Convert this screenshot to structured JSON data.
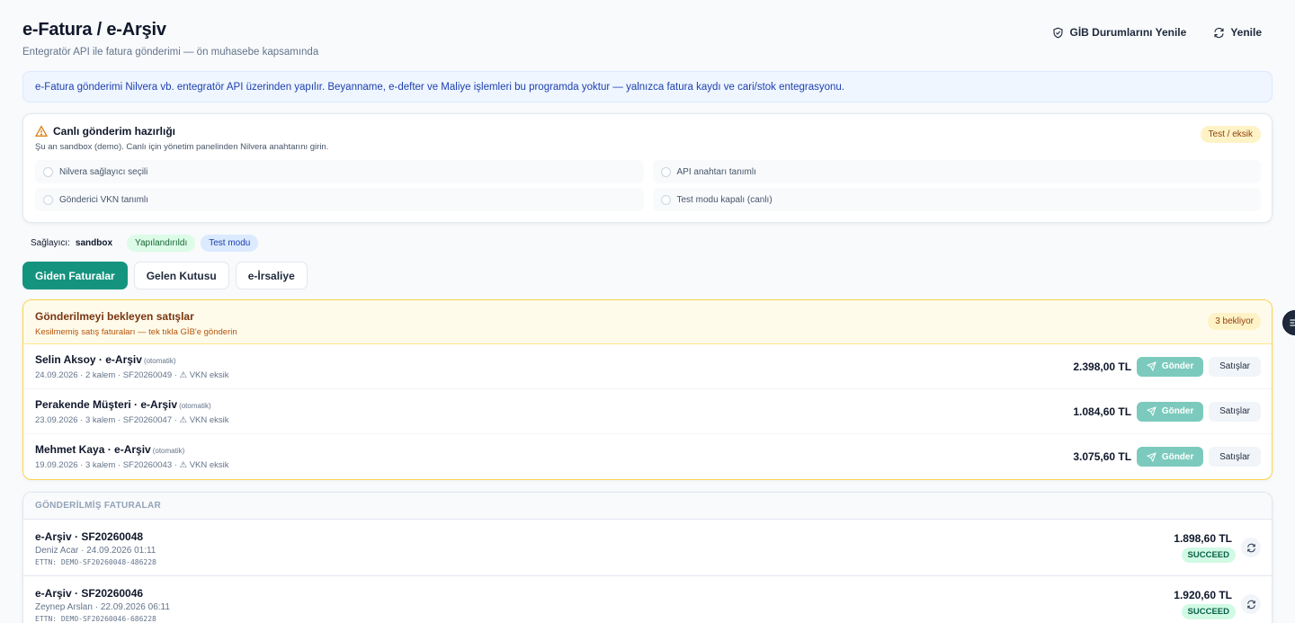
{
  "header": {
    "title": "e-Fatura / e-Arşiv",
    "subtitle": "Entegratör API ile fatura gönderimi — ön muhasebe kapsamında",
    "gib_refresh_label": "GİB Durumlarını Yenile",
    "refresh_label": "Yenile"
  },
  "info_banner": "e-Fatura gönderimi Nilvera vb. entegratör API üzerinden yapılır. Beyanname, e-defter ve Maliye işlemleri bu programda yoktur — yalnızca fatura kaydı ve cari/stok entegrasyonu.",
  "readiness": {
    "title": "Canlı gönderim hazırlığı",
    "subtitle": "Şu an sandbox (demo). Canlı için yönetim panelinden Nilvera anahtarını girin.",
    "badge": "Test / eksik",
    "checks": [
      "Nilvera sağlayıcı seçili",
      "API anahtarı tanımlı",
      "Gönderici VKN tanımlı",
      "Test modu kapalı (canlı)"
    ]
  },
  "provider": {
    "label": "Sağlayıcı:",
    "name": "sandbox",
    "status": "Yapılandırıldı",
    "mode": "Test modu"
  },
  "tabs": [
    "Giden Faturalar",
    "Gelen Kutusu",
    "e-İrsaliye"
  ],
  "pending": {
    "title": "Gönderilmeyi bekleyen satışlar",
    "subtitle": "Kesilmemiş satış faturaları — tek tıkla GİB'e gönderin",
    "badge": "3 bekliyor",
    "send_label": "Gönder",
    "sales_label": "Satışlar",
    "rows": [
      {
        "name": "Selin Aksoy · e-Arşiv",
        "tag": "(otomatik)",
        "meta": "24.09.2026 · 2 kalem · SF20260049 · ⚠ VKN eksik",
        "amount": "2.398,00 TL"
      },
      {
        "name": "Perakende Müşteri · e-Arşiv",
        "tag": "(otomatik)",
        "meta": "23.09.2026 · 3 kalem · SF20260047 · ⚠ VKN eksik",
        "amount": "1.084,60 TL"
      },
      {
        "name": "Mehmet Kaya · e-Arşiv",
        "tag": "(otomatik)",
        "meta": "19.09.2026 · 3 kalem · SF20260043 · ⚠ VKN eksik",
        "amount": "3.075,60 TL"
      }
    ]
  },
  "sent": {
    "title": "GÖNDERİLMİŞ FATURALAR",
    "rows": [
      {
        "title": "e-Arşiv · SF20260048",
        "meta": "Deniz Acar · 24.09.2026 01:11",
        "ettn": "ETTN: DEMO-SF20260048-486228",
        "amount": "1.898,60 TL",
        "status": "SUCCEED"
      },
      {
        "title": "e-Arşiv · SF20260046",
        "meta": "Zeynep Arslan · 22.09.2026 06:11",
        "ettn": "ETTN: DEMO-SF20260046-686228",
        "amount": "1.920,60 TL",
        "status": "SUCCEED"
      }
    ]
  }
}
